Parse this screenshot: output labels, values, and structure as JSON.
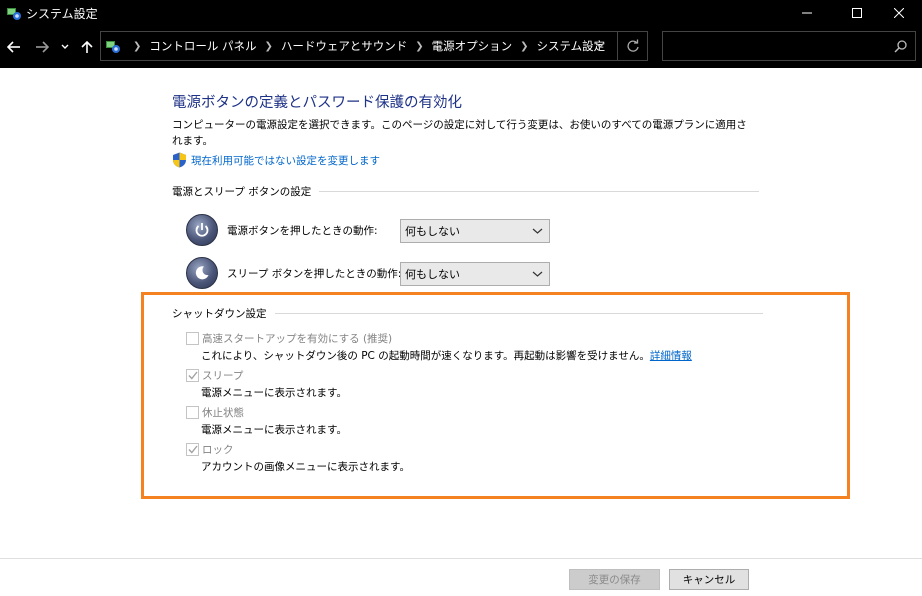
{
  "window": {
    "title": "システム設定",
    "controls": [
      "minimize-icon",
      "maximize-icon",
      "close-icon"
    ]
  },
  "nav": {
    "breadcrumbs": [
      "コントロール パネル",
      "ハードウェアとサウンド",
      "電源オプション",
      "システム設定"
    ],
    "search_placeholder": ""
  },
  "main": {
    "title": "電源ボタンの定義とパスワード保護の有効化",
    "description": "コンピューターの電源設定を選択できます。このページの設定に対して行う変更は、お使いのすべての電源プランに適用されます。",
    "admin_link": "現在利用可能ではない設定を変更します"
  },
  "power_group": {
    "header": "電源とスリープ ボタンの設定",
    "rows": [
      {
        "label": "電源ボタンを押したときの動作:",
        "value": "何もしない"
      },
      {
        "label": "スリープ ボタンを押したときの動作:",
        "value": "何もしない"
      }
    ]
  },
  "shutdown_group": {
    "header": "シャットダウン設定",
    "items": [
      {
        "label": "高速スタートアップを有効にする (推奨)",
        "checked": false,
        "desc": "これにより、シャットダウン後の PC の起動時間が速くなります。再起動は影響を受けません。",
        "link": "詳細情報"
      },
      {
        "label": "スリープ",
        "checked": true,
        "desc": "電源メニューに表示されます。"
      },
      {
        "label": "休止状態",
        "checked": false,
        "desc": "電源メニューに表示されます。"
      },
      {
        "label": "ロック",
        "checked": true,
        "desc": "アカウントの画像メニューに表示されます。"
      }
    ]
  },
  "footer": {
    "save_label": "変更の保存",
    "cancel_label": "キャンセル"
  },
  "colors": {
    "title_blue": "#1e3287",
    "link_blue": "#0066cc",
    "highlight_orange": "#f58220"
  }
}
